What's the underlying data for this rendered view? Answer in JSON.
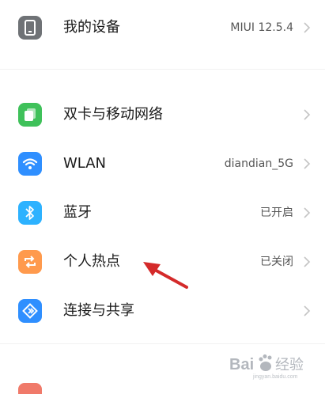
{
  "rows": [
    {
      "label": "我的设备",
      "value": "MIUI 12.5.4",
      "icon": "phone-icon",
      "color": "#6f7276"
    },
    {
      "label": "双卡与移动网络",
      "value": "",
      "icon": "sim-icon",
      "color": "#3fc15a"
    },
    {
      "label": "WLAN",
      "value": "diandian_5G",
      "icon": "wifi-icon",
      "color": "#2f8fff"
    },
    {
      "label": "蓝牙",
      "value": "已开启",
      "icon": "bluetooth-icon",
      "color": "#2db2ff"
    },
    {
      "label": "个人热点",
      "value": "已关闭",
      "icon": "hotspot-icon",
      "color": "#ff9a4d"
    },
    {
      "label": "连接与共享",
      "value": "",
      "icon": "share-icon",
      "color": "#2f8fff"
    }
  ],
  "watermark": {
    "text": "Bai经验",
    "alt": "jingyan.baidu.com"
  },
  "annotation_color": "#d42a2a"
}
